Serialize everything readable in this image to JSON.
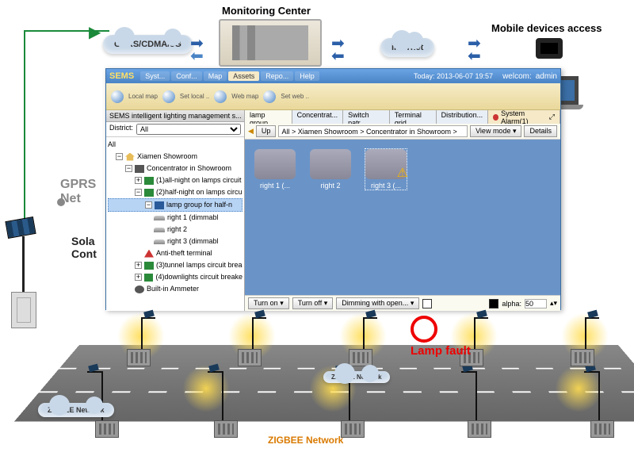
{
  "header": {
    "monitoring_center": "Monitoring Center",
    "mobile_access": "Mobile devices access",
    "gprs_cloud": "GPRS/CDMA/3G",
    "internet_cloud": "internet"
  },
  "side_labels": {
    "gprs_net": "GPRS Net",
    "solar_cont": "Sola Cont"
  },
  "app": {
    "logo": "SEMS",
    "menus": [
      "Syst...",
      "Conf...",
      "Map",
      "Assets",
      "Repo...",
      "Help"
    ],
    "menu_active_index": 3,
    "today_label": "Today: 2013-06-07 19:57",
    "welcome_label": "welcom:",
    "user": "admin",
    "toolbar": [
      "Local map",
      "Set local ..",
      "Web map",
      "Set web .."
    ],
    "sidebar_title": "SEMS intelligent lighting management s...",
    "district_label": "District:",
    "district_value": "All",
    "tree": {
      "root": "All",
      "showroom": "Xiamen Showroom",
      "concentrator": "Concentrator in Showroom",
      "c1": "(1)all-night on lamps circuit",
      "c2": "(2)half-night on lamps circu",
      "group": "lamp group for half-n",
      "r1": "right 1 (dimmabl",
      "r2": "right 2",
      "r3": "right 3 (dimmabl",
      "anti": "Anti-theft terminal",
      "c3": "(3)tunnel lamps circuit brea",
      "c4": "(4)downlights circuit breake",
      "ammeter": "Built-in Ammeter"
    },
    "tabs": [
      "lamp group...",
      "Concentrat...",
      "Switch patr...",
      "Terminal grid",
      "Distribution..."
    ],
    "tab_active_index": 0,
    "system_alarm": "System Alarm(1)",
    "crumbs": {
      "up": "Up",
      "path": "All > Xiamen Showroom > Concentrator in Showroom >",
      "view_mode": "View mode",
      "details": "Details"
    },
    "lamps": [
      {
        "name": "right 1 (...",
        "fault": false,
        "selected": false
      },
      {
        "name": "right 2",
        "fault": false,
        "selected": false
      },
      {
        "name": "right 3 (...",
        "fault": true,
        "selected": true
      }
    ],
    "bottom": {
      "turn_on": "Turn on",
      "turn_off": "Turn off",
      "dimming": "Dimming with open...",
      "alpha_label": "alpha:",
      "alpha_value": "50"
    }
  },
  "scene": {
    "lamp_fault": "Lamp fault",
    "zigbee": "ZIGBEE Network",
    "zigbee_net": "ZIGBEE Network"
  }
}
